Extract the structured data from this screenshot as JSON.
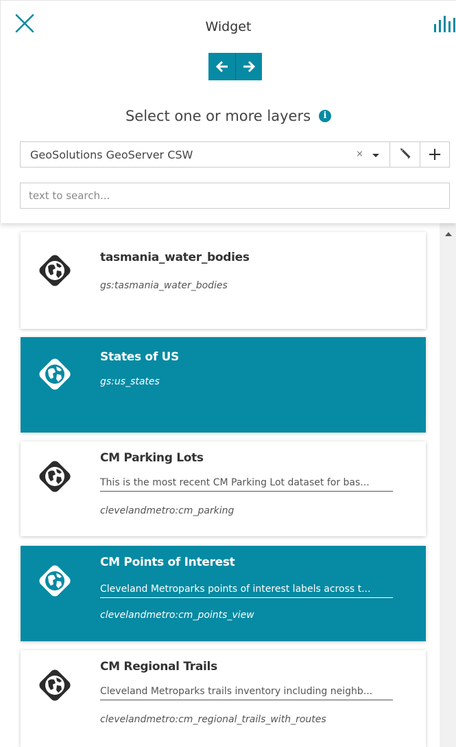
{
  "header": {
    "title": "Widget",
    "close_icon": "close-icon",
    "chart_icon": "bar-chart-icon"
  },
  "nav": {
    "back_icon": "arrow-left-icon",
    "forward_icon": "arrow-right-icon"
  },
  "selector": {
    "label": "Select one or more layers",
    "info_icon": "info-icon",
    "catalog_value": "GeoSolutions GeoServer CSW",
    "clear_symbol": "×",
    "edit_icon": "pencil-icon",
    "add_symbol": "+"
  },
  "search": {
    "placeholder": "text to search..."
  },
  "colors": {
    "accent": "#078aa3"
  },
  "layers": [
    {
      "title": "tasmania_water_bodies",
      "description": "",
      "name": "gs:tasmania_water_bodies",
      "selected": false
    },
    {
      "title": "States of US",
      "description": "",
      "name": "gs:us_states",
      "selected": true
    },
    {
      "title": "CM Parking Lots",
      "description": "This is the most recent CM Parking Lot dataset for bas...",
      "name": "clevelandmetro:cm_parking",
      "selected": false
    },
    {
      "title": "CM Points of Interest",
      "description": "Cleveland Metroparks points of interest labels across t...",
      "name": "clevelandmetro:cm_points_view",
      "selected": true
    },
    {
      "title": "CM Regional Trails",
      "description": "Cleveland Metroparks trails inventory including neighb...",
      "name": "clevelandmetro:cm_regional_trails_with_routes",
      "selected": false
    }
  ]
}
